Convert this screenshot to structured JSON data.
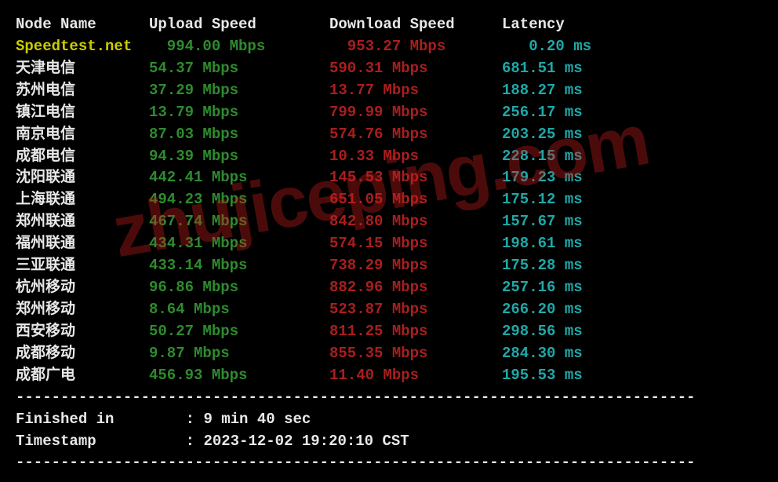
{
  "header": {
    "node": "Node Name",
    "up": "Upload Speed",
    "down": "Download Speed",
    "lat": "Latency"
  },
  "rows": [
    {
      "node": "Speedtest.net",
      "nodeClass": "y",
      "up": "994.00 Mbps",
      "upPad": 2,
      "down": "953.27 Mbps",
      "downPad": 2,
      "lat": "0.20 ms",
      "latPad": 3
    },
    {
      "node": "天津电信",
      "nodeClass": "w",
      "up": "54.37 Mbps",
      "upPad": 0,
      "down": "590.31 Mbps",
      "downPad": 0,
      "lat": "681.51 ms",
      "latPad": 0
    },
    {
      "node": "苏州电信",
      "nodeClass": "w",
      "up": "37.29 Mbps",
      "upPad": 0,
      "down": "13.77 Mbps",
      "downPad": 0,
      "lat": "188.27 ms",
      "latPad": 0
    },
    {
      "node": "镇江电信",
      "nodeClass": "w",
      "up": "13.79 Mbps",
      "upPad": 0,
      "down": "799.99 Mbps",
      "downPad": 0,
      "lat": "256.17 ms",
      "latPad": 0
    },
    {
      "node": "南京电信",
      "nodeClass": "w",
      "up": "87.03 Mbps",
      "upPad": 0,
      "down": "574.76 Mbps",
      "downPad": 0,
      "lat": "203.25 ms",
      "latPad": 0
    },
    {
      "node": "成都电信",
      "nodeClass": "w",
      "up": "94.39 Mbps",
      "upPad": 0,
      "down": "10.33 Mbps",
      "downPad": 0,
      "lat": "228.15 ms",
      "latPad": 0
    },
    {
      "node": "沈阳联通",
      "nodeClass": "w",
      "up": "442.41 Mbps",
      "upPad": 0,
      "down": "145.53 Mbps",
      "downPad": 0,
      "lat": "179.23 ms",
      "latPad": 0
    },
    {
      "node": "上海联通",
      "nodeClass": "w",
      "up": "494.23 Mbps",
      "upPad": 0,
      "down": "651.05 Mbps",
      "downPad": 0,
      "lat": "175.12 ms",
      "latPad": 0
    },
    {
      "node": "郑州联通",
      "nodeClass": "w",
      "up": "467.74 Mbps",
      "upPad": 0,
      "down": "842.80 Mbps",
      "downPad": 0,
      "lat": "157.67 ms",
      "latPad": 0
    },
    {
      "node": "福州联通",
      "nodeClass": "w",
      "up": "434.31 Mbps",
      "upPad": 0,
      "down": "574.15 Mbps",
      "downPad": 0,
      "lat": "198.61 ms",
      "latPad": 0
    },
    {
      "node": "三亚联通",
      "nodeClass": "w",
      "up": "433.14 Mbps",
      "upPad": 0,
      "down": "738.29 Mbps",
      "downPad": 0,
      "lat": "175.28 ms",
      "latPad": 0
    },
    {
      "node": "杭州移动",
      "nodeClass": "w",
      "up": "96.86 Mbps",
      "upPad": 0,
      "down": "882.96 Mbps",
      "downPad": 0,
      "lat": "257.16 ms",
      "latPad": 0
    },
    {
      "node": "郑州移动",
      "nodeClass": "w",
      "up": "8.64 Mbps",
      "upPad": 0,
      "down": "523.87 Mbps",
      "downPad": 0,
      "lat": "266.20 ms",
      "latPad": 0
    },
    {
      "node": "西安移动",
      "nodeClass": "w",
      "up": "50.27 Mbps",
      "upPad": 0,
      "down": "811.25 Mbps",
      "downPad": 0,
      "lat": "298.56 ms",
      "latPad": 0
    },
    {
      "node": "成都移动",
      "nodeClass": "w",
      "up": "9.87 Mbps",
      "upPad": 0,
      "down": "855.35 Mbps",
      "downPad": 0,
      "lat": "284.30 ms",
      "latPad": 0
    },
    {
      "node": "成都广电",
      "nodeClass": "w",
      "up": "456.93 Mbps",
      "upPad": 0,
      "down": "11.40 Mbps",
      "downPad": 0,
      "lat": "195.53 ms",
      "latPad": 0
    }
  ],
  "separator": "----------------------------------------------------------------------------",
  "footer": {
    "finished_label": "Finished in",
    "finished_value": "9 min 40 sec",
    "timestamp_label": "Timestamp",
    "timestamp_value": "2023-12-02 19:20:10 CST"
  },
  "watermark": "zhujiceping.com"
}
